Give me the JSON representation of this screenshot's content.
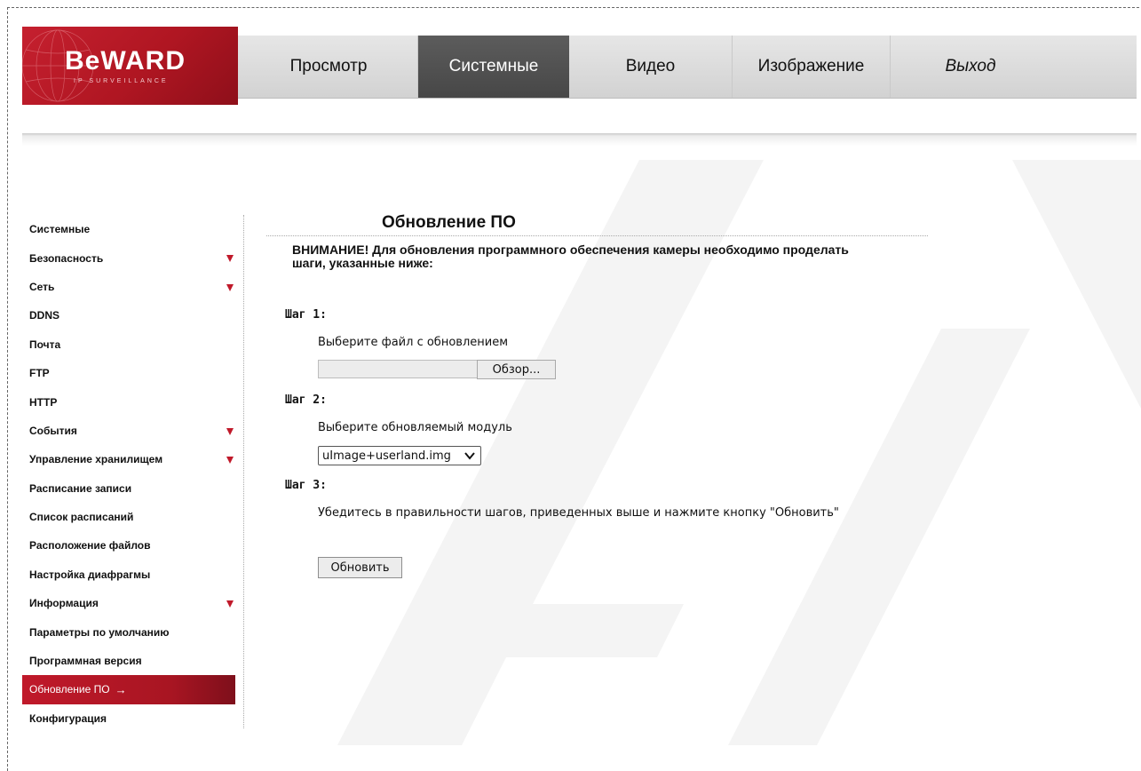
{
  "brand": {
    "name": "BeWARD",
    "tagline": "IP SURVEILLANCE"
  },
  "nav": [
    {
      "label": "Просмотр",
      "active": false
    },
    {
      "label": "Системные",
      "active": true
    },
    {
      "label": "Видео",
      "active": false
    },
    {
      "label": "Изображение",
      "active": false
    },
    {
      "label": "Выход",
      "active": false
    }
  ],
  "sidebar": {
    "items": [
      {
        "label": "Системные",
        "expandable": false
      },
      {
        "label": "Безопасность",
        "expandable": true
      },
      {
        "label": "Сеть",
        "expandable": true
      },
      {
        "label": "DDNS",
        "expandable": false
      },
      {
        "label": "Почта",
        "expandable": false
      },
      {
        "label": "FTP",
        "expandable": false
      },
      {
        "label": "HTTP",
        "expandable": false
      },
      {
        "label": "События",
        "expandable": true
      },
      {
        "label": "Управление хранилищем",
        "expandable": true
      },
      {
        "label": "Расписание записи",
        "expandable": false
      },
      {
        "label": "Список расписаний",
        "expandable": false
      },
      {
        "label": "Расположение файлов",
        "expandable": false
      },
      {
        "label": "Настройка диафрагмы",
        "expandable": false
      },
      {
        "label": "Информация",
        "expandable": true
      },
      {
        "label": "Параметры по умолчанию",
        "expandable": false
      },
      {
        "label": "Программная версия",
        "expandable": false
      },
      {
        "label": "Обновление ПО",
        "expandable": false,
        "active": true
      },
      {
        "label": "Конфигурация",
        "expandable": false
      }
    ],
    "active_marker": "→"
  },
  "main": {
    "title": "Обновление ПО",
    "warning": "ВНИМАНИЕ! Для обновления программного обеспечения камеры необходимо проделать шаги, указанные ниже:",
    "step1": {
      "label": "Шаг 1:",
      "desc": "Выберите файл с обновлением",
      "file_value": "",
      "browse_label": "Обзор..."
    },
    "step2": {
      "label": "Шаг 2:",
      "desc": "Выберите обновляемый модуль",
      "module_selected": "uImage+userland.img"
    },
    "step3": {
      "label": "Шаг 3:",
      "desc": "Убедитесь в правильности шагов, приведенных выше и нажмите кнопку \"Обновить\""
    },
    "update_label": "Обновить"
  },
  "colors": {
    "accent": "#c0192a",
    "nav_active": "#4f4f4f",
    "header_bg": "#dcdcdc"
  }
}
